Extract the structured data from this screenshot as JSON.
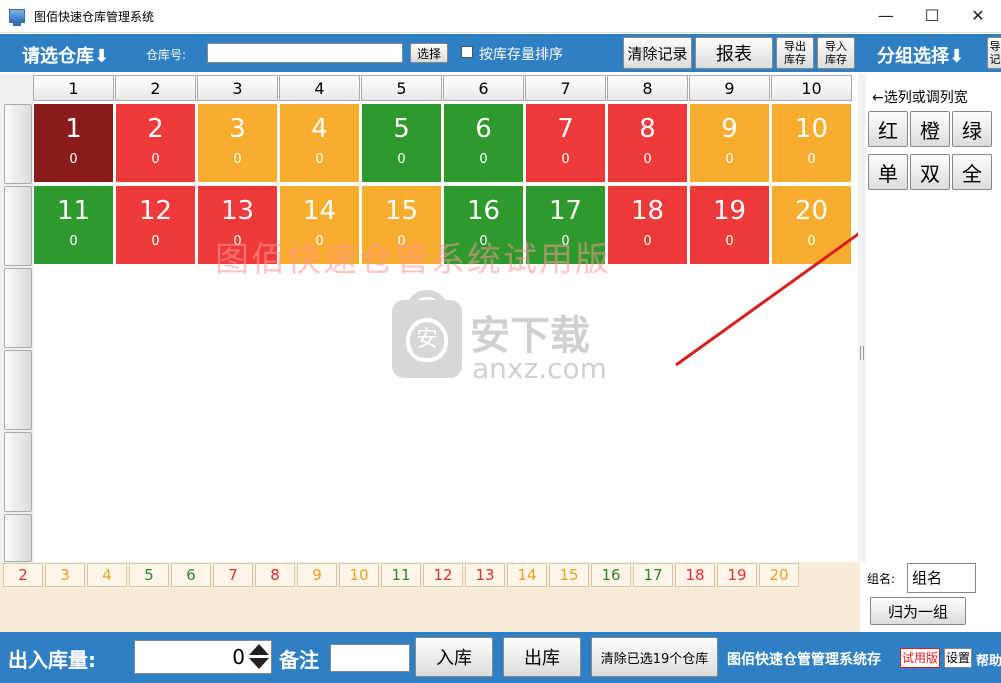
{
  "window": {
    "title": "图佰快速仓库管理系统",
    "min": "—",
    "max": "☐",
    "close": "✕"
  },
  "toolbar": {
    "select_warehouse": "请选仓库⬇",
    "warehouse_no_label": "仓库号:",
    "warehouse_no_value": "",
    "choose": "选择",
    "sort_by_stock": "按库存量排序",
    "sort_checked": false,
    "clear_records": "清除记录",
    "report": "报表",
    "export_stock_1": "导出",
    "export_stock_2": "库存",
    "import_stock_1": "导入",
    "import_stock_2": "库存",
    "group_select": "分组选择⬇",
    "export_records_1": "导",
    "export_records_2": "记"
  },
  "columns": [
    "1",
    "2",
    "3",
    "4",
    "5",
    "6",
    "7",
    "8",
    "9",
    "10"
  ],
  "grid": [
    {
      "num": "1",
      "count": "0",
      "color": "#8b1a1a"
    },
    {
      "num": "2",
      "count": "0",
      "color": "#f03a3a"
    },
    {
      "num": "3",
      "count": "0",
      "color": "#f8ad2e"
    },
    {
      "num": "4",
      "count": "0",
      "color": "#f8ad2e"
    },
    {
      "num": "5",
      "count": "0",
      "color": "#2e9a2e"
    },
    {
      "num": "6",
      "count": "0",
      "color": "#2e9a2e"
    },
    {
      "num": "7",
      "count": "0",
      "color": "#f03a3a"
    },
    {
      "num": "8",
      "count": "0",
      "color": "#f03a3a"
    },
    {
      "num": "9",
      "count": "0",
      "color": "#f8ad2e"
    },
    {
      "num": "10",
      "count": "0",
      "color": "#f8ad2e"
    },
    {
      "num": "11",
      "count": "0",
      "color": "#2e9a2e"
    },
    {
      "num": "12",
      "count": "0",
      "color": "#f03a3a"
    },
    {
      "num": "13",
      "count": "0",
      "color": "#f03a3a"
    },
    {
      "num": "14",
      "count": "0",
      "color": "#f8ad2e"
    },
    {
      "num": "15",
      "count": "0",
      "color": "#f8ad2e"
    },
    {
      "num": "16",
      "count": "0",
      "color": "#2e9a2e"
    },
    {
      "num": "17",
      "count": "0",
      "color": "#2e9a2e"
    },
    {
      "num": "18",
      "count": "0",
      "color": "#f03a3a"
    },
    {
      "num": "19",
      "count": "0",
      "color": "#f03a3a"
    },
    {
      "num": "20",
      "count": "0",
      "color": "#f8ad2e"
    }
  ],
  "watermark": "图佰快速仓管系统试用版",
  "logo": {
    "name": "安下载",
    "url": "anxz.com",
    "badge": "安"
  },
  "right_panel": {
    "hint": "←选列或调列宽",
    "buttons": [
      "红",
      "橙",
      "绿",
      "单",
      "双",
      "全"
    ],
    "group_name_label": "组名:",
    "group_name_value": "组名",
    "make_group": "归为一组"
  },
  "chips": [
    {
      "t": "2",
      "c": "#e03030"
    },
    {
      "t": "3",
      "c": "#f0a020"
    },
    {
      "t": "4",
      "c": "#f0a020"
    },
    {
      "t": "5",
      "c": "#2a8a2a"
    },
    {
      "t": "6",
      "c": "#2a8a2a"
    },
    {
      "t": "7",
      "c": "#e03030"
    },
    {
      "t": "8",
      "c": "#e03030"
    },
    {
      "t": "9",
      "c": "#f0a020"
    },
    {
      "t": "10",
      "c": "#f0a020"
    },
    {
      "t": "11",
      "c": "#2a8a2a"
    },
    {
      "t": "12",
      "c": "#e03030"
    },
    {
      "t": "13",
      "c": "#e03030"
    },
    {
      "t": "14",
      "c": "#f0a020"
    },
    {
      "t": "15",
      "c": "#f0a020"
    },
    {
      "t": "16",
      "c": "#2a8a2a"
    },
    {
      "t": "17",
      "c": "#2a8a2a"
    },
    {
      "t": "18",
      "c": "#e03030"
    },
    {
      "t": "19",
      "c": "#e03030"
    },
    {
      "t": "20",
      "c": "#f0a020"
    }
  ],
  "status": {
    "qty_label": "出入库量:",
    "qty_value": "0",
    "note_label": "备注",
    "in_stock": "入库",
    "out_stock": "出库",
    "clear_selected": "清除已选19个仓库",
    "app_name": "图佰快速仓管管理系统存",
    "trial": "试用版",
    "settings": "设置",
    "help": "帮助"
  }
}
